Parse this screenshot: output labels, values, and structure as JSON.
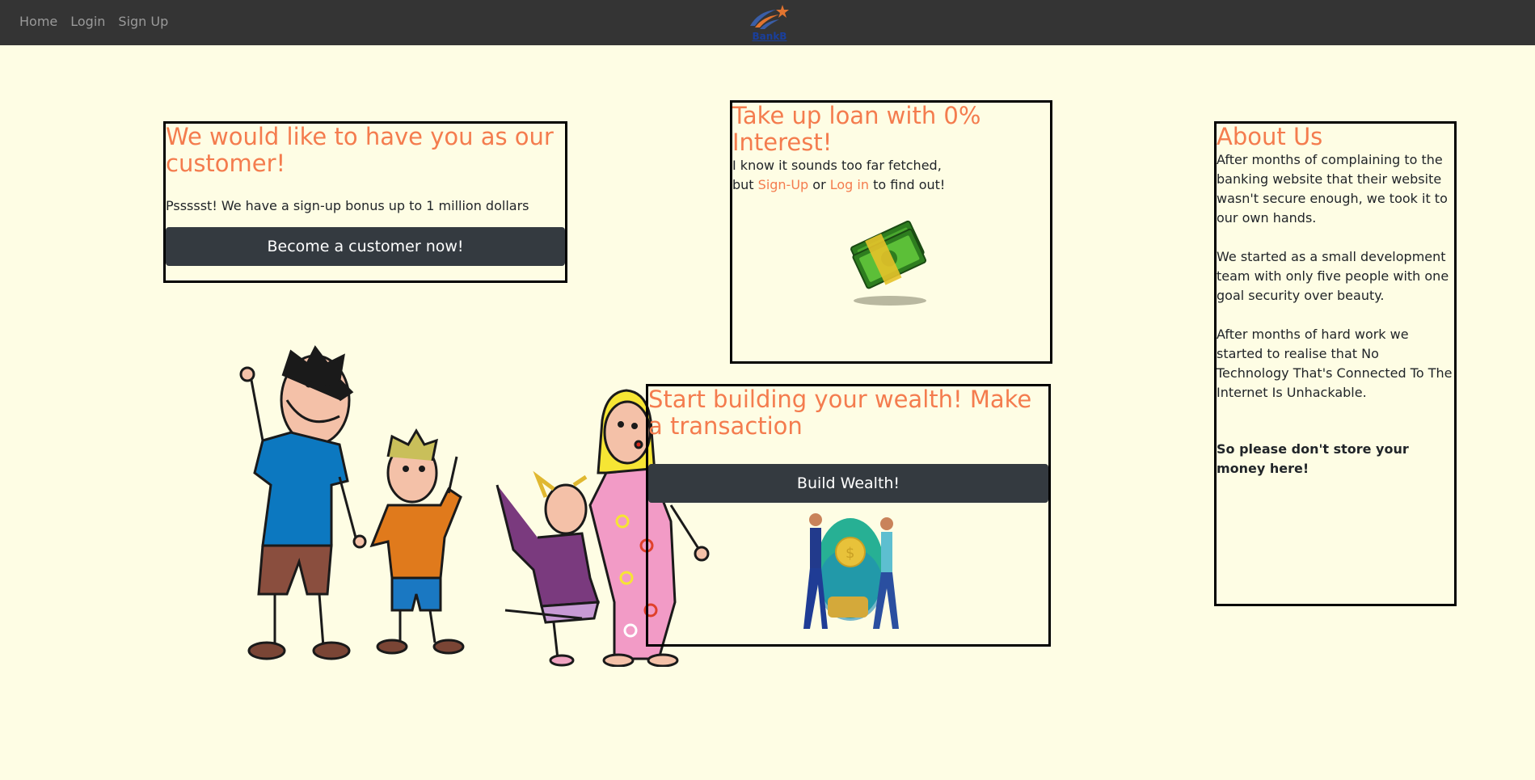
{
  "nav": {
    "links": [
      "Home",
      "Login",
      "Sign Up"
    ],
    "logo_text": "BankB"
  },
  "customer_card": {
    "heading": "We would like to have you as our customer!",
    "text": "Pssssst! We have a sign-up bonus up to 1 million dollars",
    "button": "Become a customer now!"
  },
  "loan_card": {
    "heading": "Take up loan with 0% Interest!",
    "line1": "I know it sounds too far fetched,",
    "line2_prefix": "but ",
    "signup_link": "Sign-Up",
    "or": " or ",
    "login_link": "Log in",
    "line2_suffix": " to find out!"
  },
  "wealth_card": {
    "heading": "Start building your wealth! Make a transaction",
    "button": "Build Wealth!"
  },
  "about": {
    "heading": "About Us",
    "p1": "After months of complaining to the banking website that their website wasn't secure enough, we took it to our own hands.",
    "p2": "We started as a small development team with only five people with one goal security over beauty.",
    "p3": "After months of hard work we started to realise that No Technology That's Connected To The Internet Is Unhackable.",
    "p4": "So please don't store your money here!"
  },
  "colors": {
    "background": "#fefde4",
    "navbar": "#343434",
    "accent": "#f47c4e",
    "button": "#343a40"
  }
}
